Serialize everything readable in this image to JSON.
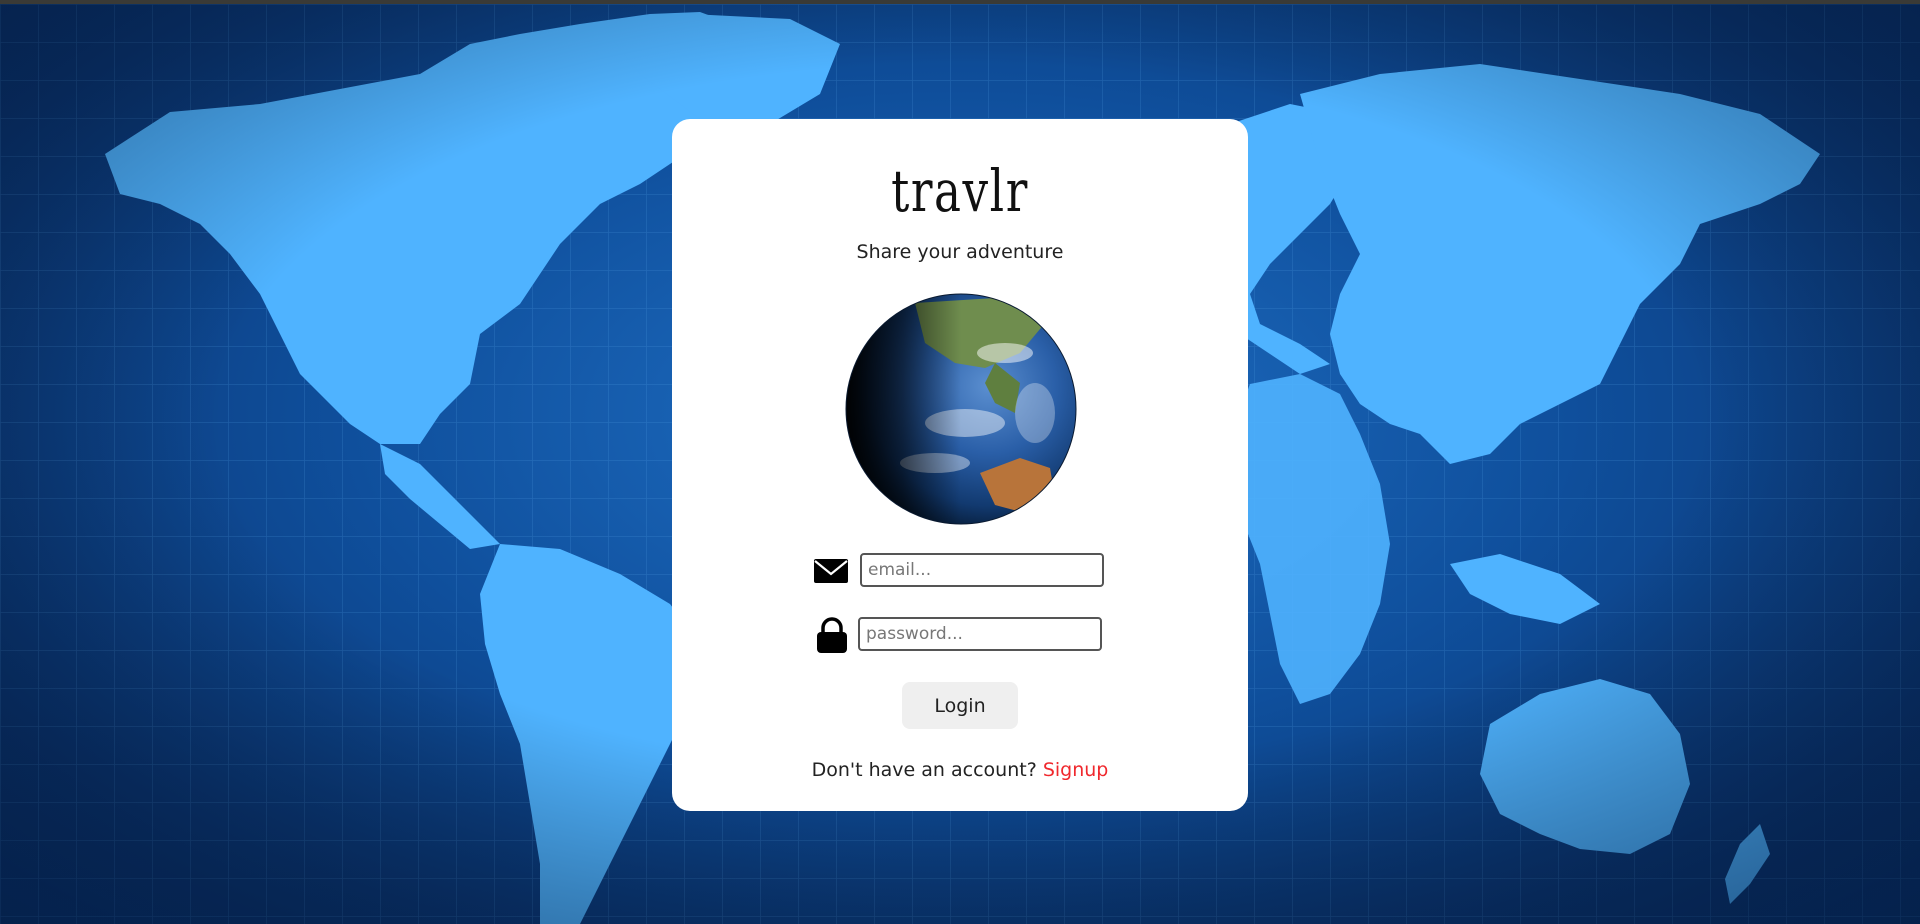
{
  "app": {
    "brand": "travlr",
    "tagline": "Share your adventure"
  },
  "login_form": {
    "email": {
      "value": "",
      "placeholder": "email...",
      "icon": "envelope-icon"
    },
    "password": {
      "value": "",
      "placeholder": "password...",
      "icon": "lock-icon"
    },
    "login_label": "Login"
  },
  "signup": {
    "prompt": "Don't have an account?",
    "link_label": "Signup",
    "link_color": "#f0282d"
  },
  "colors": {
    "background": "#0f4f9c",
    "continents": "#4fb3ff",
    "card": "#ffffff"
  }
}
